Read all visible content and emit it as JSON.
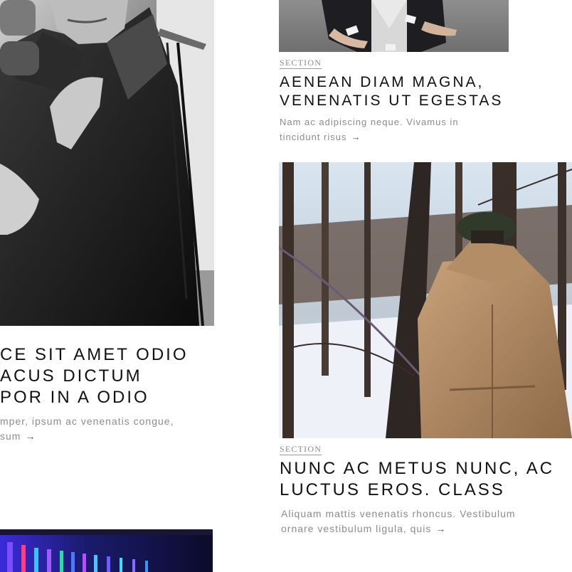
{
  "left_column": {
    "top_card": {
      "image": {
        "alt": "black and white photo of a singer at a microphone",
        "icon": "photo-singer"
      },
      "headline_lines": [
        "CE SIT AMET ODIO",
        "ACUS DICTUM",
        "POR IN A ODIO"
      ],
      "excerpt_lines": [
        "mper, ipsum ac venenatis congue,",
        "sum"
      ],
      "arrow": "→"
    },
    "bottom_card": {
      "image": {
        "alt": "colorful neon lights photo",
        "icon": "photo-neon"
      }
    }
  },
  "right_column": {
    "top_card": {
      "image": {
        "alt": "man in jacket holding cards",
        "icon": "photo-man-jacket"
      },
      "section_label": "SECTION",
      "headline_lines": [
        "AENEAN DIAM MAGNA,",
        "VENENATIS UT EGESTAS"
      ],
      "excerpt_lines": [
        "Nam ac adipiscing neque. Vivamus in",
        "tincidunt risus"
      ],
      "arrow": "→"
    },
    "bottom_card": {
      "image": {
        "alt": "man in camel coat and green beret in snowy forest",
        "icon": "photo-forest"
      },
      "section_label": "SECTION",
      "headline_lines": [
        "NUNC AC METUS NUNC, AC",
        "LUCTUS EROS. CLASS"
      ],
      "excerpt_lines": [
        "Aliquam mattis venenatis rhoncus. Vestibulum",
        "ornare vestibulum ligula, quis"
      ],
      "arrow": "→"
    }
  },
  "colors": {
    "background": "#ffffff",
    "text": "#111111",
    "muted": "#8c8c8c"
  }
}
